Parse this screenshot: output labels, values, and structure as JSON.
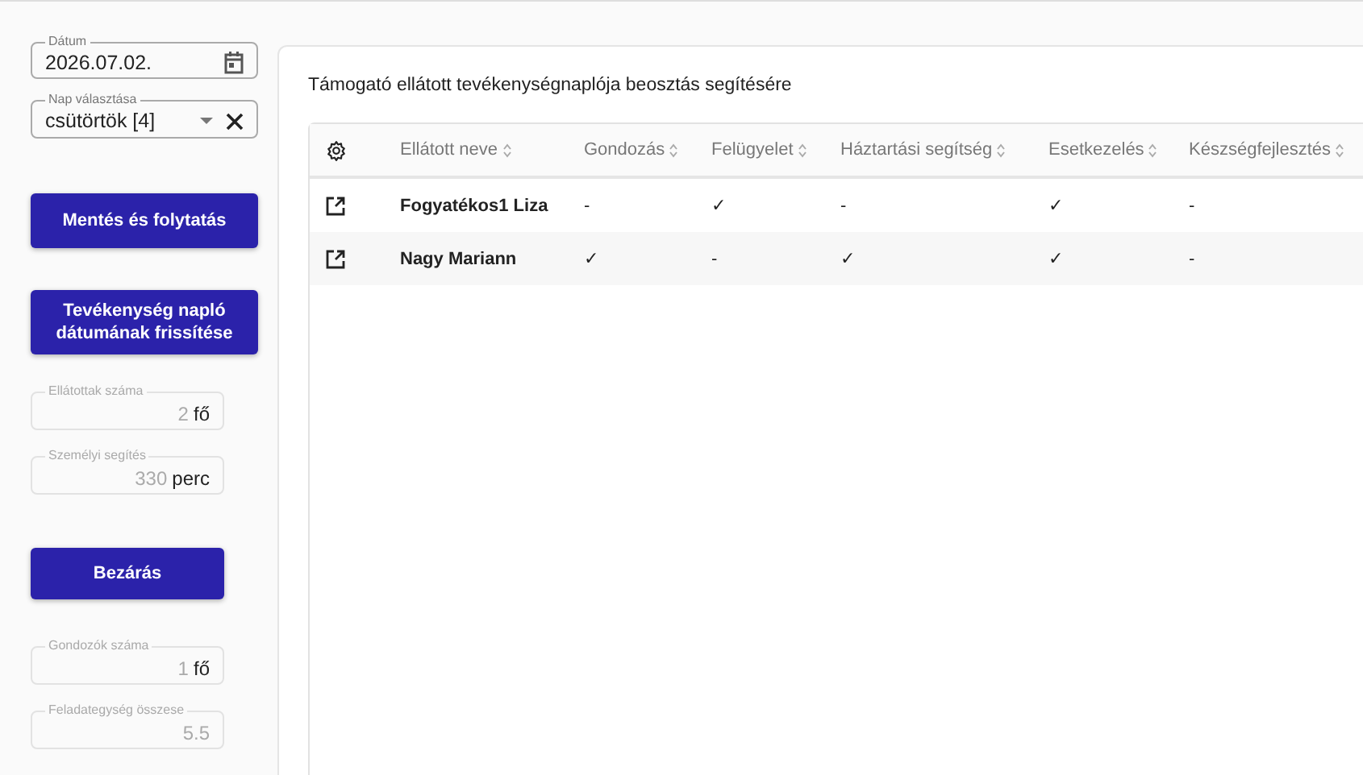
{
  "date_field": {
    "label": "Dátum",
    "value": "2026.07.02."
  },
  "day_select": {
    "label": "Nap választása",
    "value": "csütörtök [4]"
  },
  "sidebar_top_buttons": [
    "Mentés és folytatás",
    "Tevékenység napló dátumának frissítése"
  ],
  "summary_fields": [
    {
      "label": "Ellátottak száma",
      "value": "2",
      "unit": "fő"
    },
    {
      "label": "Személyi segítés",
      "value": "330",
      "unit": "perc"
    }
  ],
  "close_button": "Bezárás",
  "bottom_fields": [
    {
      "label": "Gondozók száma",
      "value": "1",
      "unit": "fő"
    },
    {
      "label": "Feladategység összese",
      "value": "5.5"
    }
  ],
  "panel_title": "Támogató ellátott tevékenységnaplója beosztás segítésére",
  "table": {
    "columns": [
      "Ellátott neve",
      "Gondozás",
      "Felügyelet",
      "Háztartási segítség",
      "Esetkezelés",
      "Készségfejlesztés"
    ],
    "rows": [
      {
        "cells": [
          "Fogyatékos1 Liza",
          "-",
          "✓",
          "-",
          "✓",
          "-"
        ]
      },
      {
        "cells": [
          "Nagy Mariann",
          "✓",
          "-",
          "✓",
          "✓",
          "-"
        ]
      }
    ]
  }
}
